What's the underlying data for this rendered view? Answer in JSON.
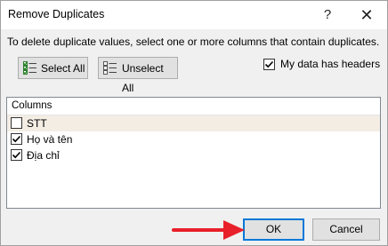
{
  "dialog": {
    "title": "Remove Duplicates",
    "help_glyph": "?",
    "close_glyph": "✕",
    "instruction": "To delete duplicate values, select one or more columns that contain duplicates.",
    "select_all_label": "Select All",
    "unselect_all_label": "Unselect All",
    "headers_label": "My data has headers",
    "headers_checked": true,
    "columns_header": "Columns",
    "columns": [
      {
        "label": "STT",
        "checked": false
      },
      {
        "label": "Họ và tên",
        "checked": true
      },
      {
        "label": "Địa chỉ",
        "checked": true
      }
    ],
    "ok_label": "OK",
    "cancel_label": "Cancel"
  },
  "annotation": {
    "arrow_color": "#e8202a"
  },
  "colors": {
    "focus_border": "#0078d7",
    "highlight_row": "#f3ede4"
  }
}
